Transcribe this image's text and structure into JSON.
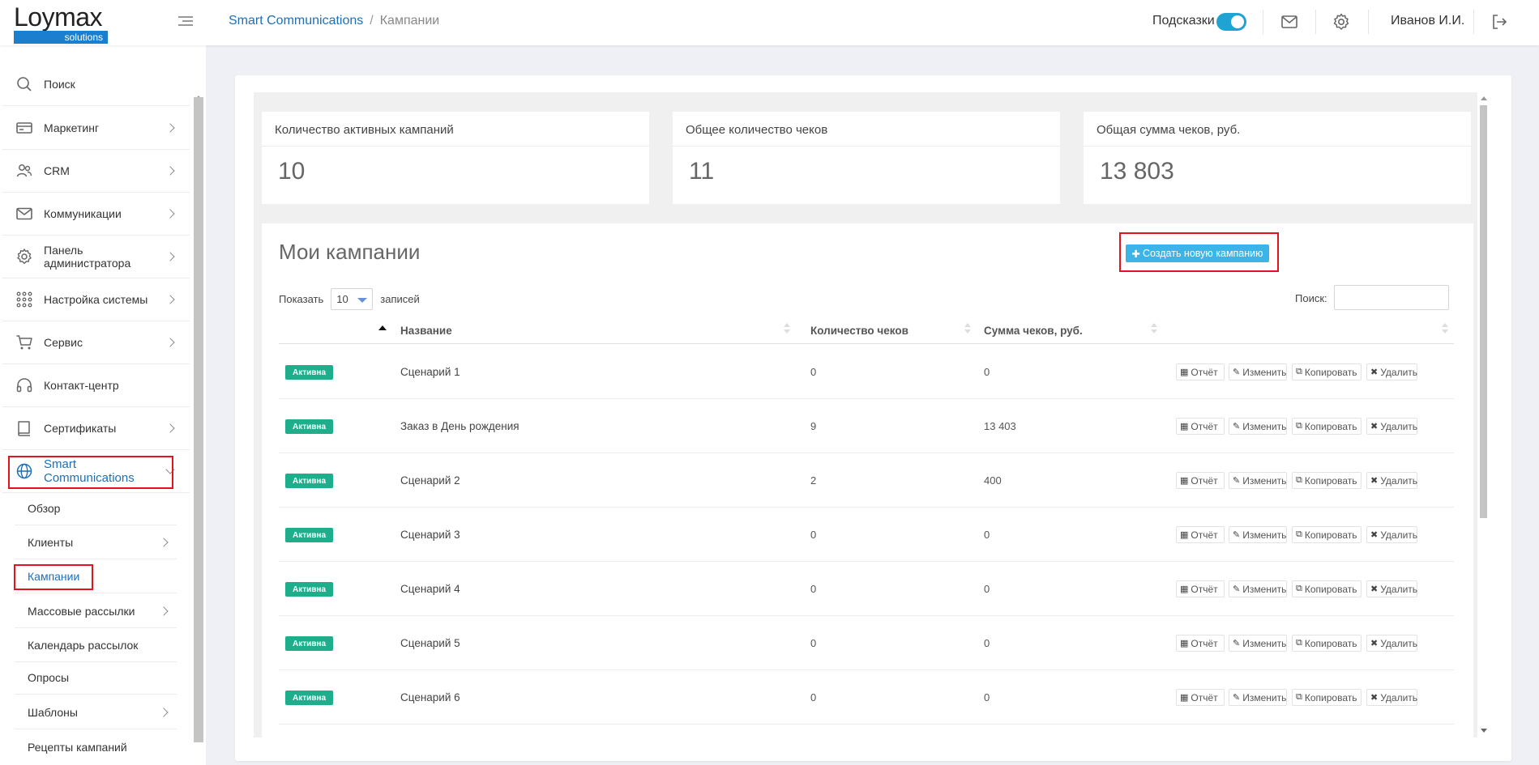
{
  "header": {
    "logo_main": "Loymax",
    "logo_sub": "solutions",
    "breadcrumb_link": "Smart Communications",
    "breadcrumb_sep": "/",
    "breadcrumb_current": "Кампании",
    "hints_label": "Подсказки",
    "hints_enabled": true,
    "user_name": "Иванов И.И."
  },
  "sidebar": {
    "items": [
      {
        "label": "Поиск",
        "icon": "search-icon",
        "has_chevron": false
      },
      {
        "label": "Маркетинг",
        "icon": "card-icon",
        "has_chevron": true
      },
      {
        "label": "CRM",
        "icon": "users-icon",
        "has_chevron": true
      },
      {
        "label": "Коммуникации",
        "icon": "envelope-icon",
        "has_chevron": true
      },
      {
        "label": "Панель администратора",
        "icon": "gear-icon",
        "has_chevron": true
      },
      {
        "label": "Настройка системы",
        "icon": "grid-dots-icon",
        "has_chevron": true
      },
      {
        "label": "Сервис",
        "icon": "cart-icon",
        "has_chevron": true
      },
      {
        "label": "Контакт-центр",
        "icon": "headset-icon",
        "has_chevron": false
      },
      {
        "label": "Сертификаты",
        "icon": "book-icon",
        "has_chevron": true
      },
      {
        "label": "Smart Communications",
        "icon": "globe-icon",
        "has_chevron": true,
        "active": true
      }
    ],
    "subitems": [
      {
        "label": "Обзор",
        "has_chevron": false
      },
      {
        "label": "Клиенты",
        "has_chevron": true
      },
      {
        "label": "Кампании",
        "has_chevron": false,
        "active": true
      },
      {
        "label": "Массовые рассылки",
        "has_chevron": true
      },
      {
        "label": "Календарь рассылок",
        "has_chevron": false
      },
      {
        "label": "Опросы",
        "has_chevron": false
      },
      {
        "label": "Шаблоны",
        "has_chevron": true
      },
      {
        "label": "Рецепты кампаний",
        "has_chevron": false
      }
    ]
  },
  "stats": [
    {
      "title": "Количество активных кампаний",
      "value": "10"
    },
    {
      "title": "Общее количество чеков",
      "value": "11"
    },
    {
      "title": "Общая сумма чеков, руб.",
      "value": "13 803"
    }
  ],
  "campaigns": {
    "title": "Мои кампании",
    "create_button": "Создать новую кампанию",
    "show_label": "Показать",
    "page_size": "10",
    "records_label": "записей",
    "search_label": "Поиск:",
    "search_value": "",
    "columns": {
      "name": "Название",
      "count": "Количество чеков",
      "sum": "Сумма чеков, руб."
    },
    "actions": {
      "report": "Отчёт",
      "edit": "Изменить",
      "copy": "Копировать",
      "delete": "Удалить"
    },
    "rows": [
      {
        "status": "Активна",
        "name": "Сценарий 1",
        "count": "0",
        "sum": "0"
      },
      {
        "status": "Активна",
        "name": "Заказ в День рождения",
        "count": "9",
        "sum": "13 403"
      },
      {
        "status": "Активна",
        "name": "Сценарий 2",
        "count": "2",
        "sum": "400"
      },
      {
        "status": "Активна",
        "name": "Сценарий 3",
        "count": "0",
        "sum": "0"
      },
      {
        "status": "Активна",
        "name": "Сценарий 4",
        "count": "0",
        "sum": "0"
      },
      {
        "status": "Активна",
        "name": "Сценарий 5",
        "count": "0",
        "sum": "0"
      },
      {
        "status": "Активна",
        "name": "Сценарий 6",
        "count": "0",
        "sum": "0"
      }
    ]
  },
  "colors": {
    "accent": "#1e6fb7",
    "toggle": "#1fa3d2",
    "badge": "#1fae8c",
    "button": "#3cb4e8",
    "highlight": "#e0141e"
  }
}
